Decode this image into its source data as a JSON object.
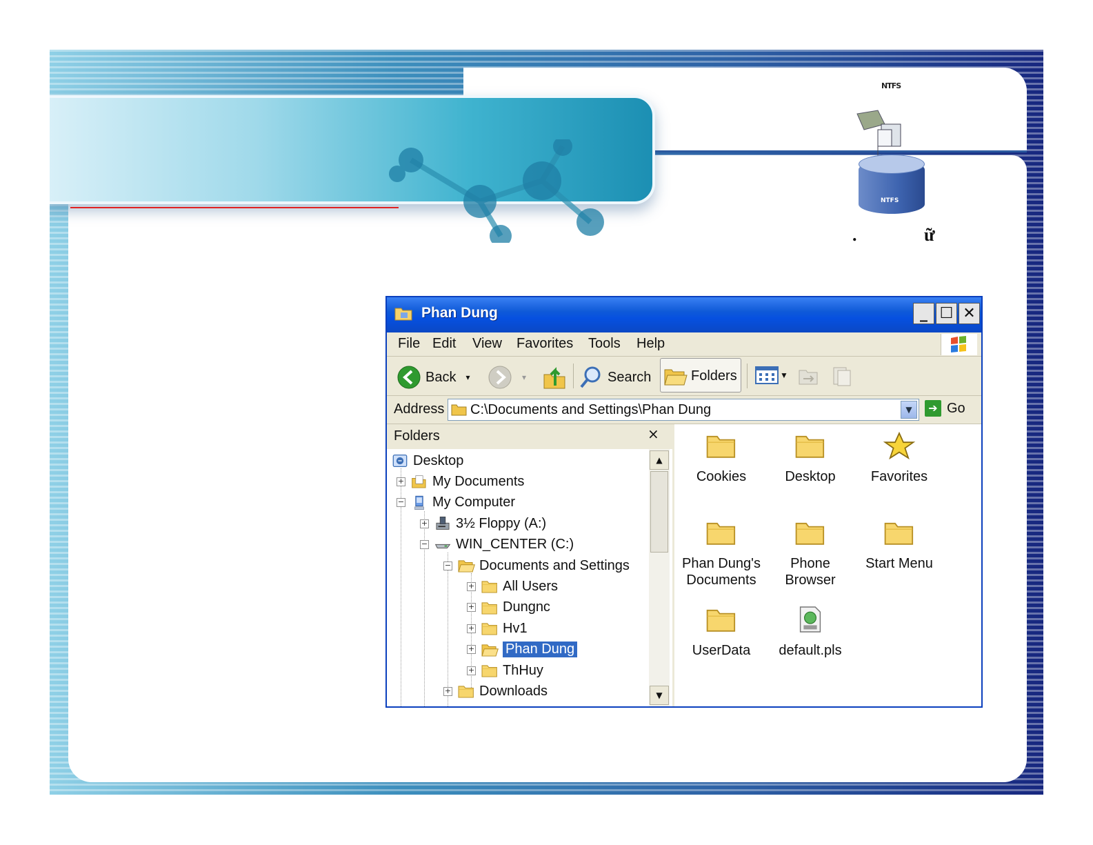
{
  "slide": {
    "ntfs_caption": "NTFS",
    "ntfs_drum_label": "NTFS",
    "title_fragments": [
      ".",
      "ữ"
    ]
  },
  "window": {
    "title": "Phan Dung",
    "controls": {
      "minimize": "_",
      "maximize": "☐",
      "close": "✕"
    }
  },
  "menu": [
    "File",
    "Edit",
    "View",
    "Favorites",
    "Tools",
    "Help"
  ],
  "toolbar": {
    "back": "Back",
    "search": "Search",
    "folders": "Folders"
  },
  "address": {
    "label": "Address",
    "value": "C:\\Documents and Settings\\Phan Dung",
    "go": "Go"
  },
  "folders_pane": {
    "title": "Folders",
    "close": "×",
    "tree": [
      {
        "label": "Desktop",
        "icon": "desktop-icon",
        "level": 0,
        "expander": ""
      },
      {
        "label": "My Documents",
        "icon": "my-documents-icon",
        "level": 1,
        "expander": "+"
      },
      {
        "label": "My Computer",
        "icon": "my-computer-icon",
        "level": 1,
        "expander": "−"
      },
      {
        "label": "3½ Floppy (A:)",
        "icon": "floppy-drive-icon",
        "level": 2,
        "expander": "+"
      },
      {
        "label": "WIN_CENTER (C:)",
        "icon": "hard-drive-icon",
        "level": 2,
        "expander": "−"
      },
      {
        "label": "Documents and Settings",
        "icon": "folder-open-icon",
        "level": 3,
        "expander": "−"
      },
      {
        "label": "All Users",
        "icon": "folder-icon",
        "level": 4,
        "expander": "+"
      },
      {
        "label": "Dungnc",
        "icon": "folder-icon",
        "level": 4,
        "expander": "+"
      },
      {
        "label": "Hv1",
        "icon": "folder-icon",
        "level": 4,
        "expander": "+"
      },
      {
        "label": "Phan Dung",
        "icon": "folder-open-icon",
        "level": 4,
        "expander": "+",
        "selected": true
      },
      {
        "label": "ThHuy",
        "icon": "folder-icon",
        "level": 4,
        "expander": "+"
      },
      {
        "label": "Downloads",
        "icon": "folder-icon",
        "level": 3,
        "expander": "+"
      }
    ],
    "scroll_up": "▲",
    "scroll_down": "▼"
  },
  "content": {
    "items": [
      {
        "label": "Cookies",
        "icon": "folder-icon"
      },
      {
        "label": "Desktop",
        "icon": "folder-icon"
      },
      {
        "label": "Favorites",
        "icon": "star-icon"
      },
      {
        "label": "Phan Dung's Documents",
        "icon": "folder-icon"
      },
      {
        "label": "Phone Browser",
        "icon": "folder-icon"
      },
      {
        "label": "Start Menu",
        "icon": "folder-icon"
      },
      {
        "label": "UserData",
        "icon": "folder-icon"
      },
      {
        "label": "default.pls",
        "icon": "playlist-file-icon"
      }
    ]
  },
  "colors": {
    "titlebar": "#0650e0",
    "selection": "#316ac5",
    "window_face": "#ece9d8",
    "banner_accent": "#e02222"
  }
}
